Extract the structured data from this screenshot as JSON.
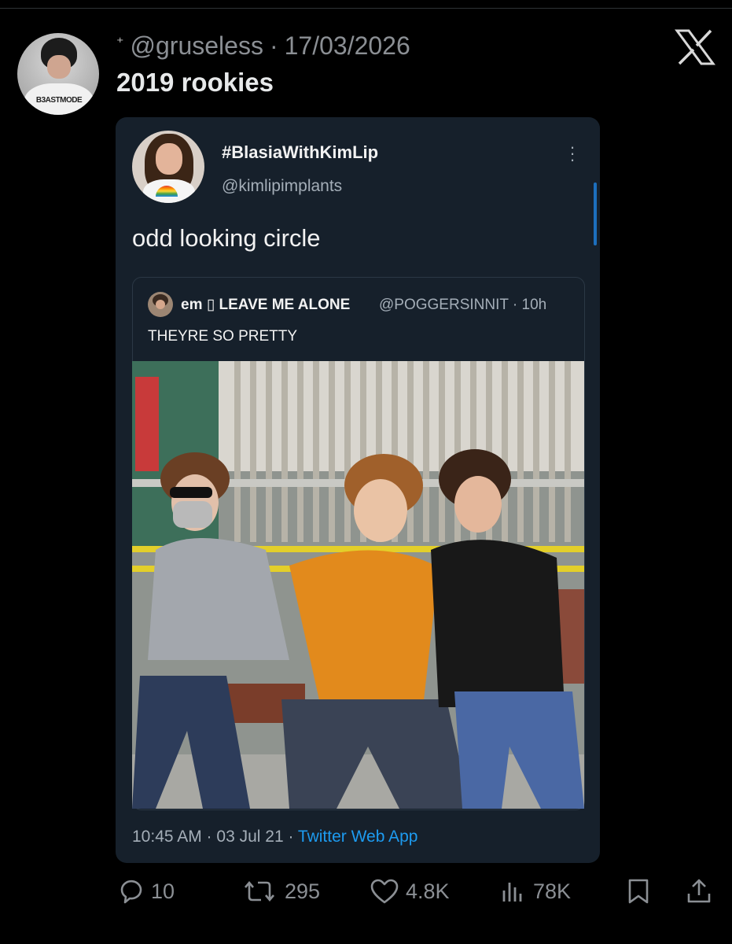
{
  "post": {
    "sparkle": "⁺",
    "handle": "@gruseless",
    "date": "17/03/2026",
    "text": "2019 rookies",
    "avatar_shirt_text": "B3ASTMODE"
  },
  "quoted": {
    "name": "#BlasiaWithKimLip",
    "handle": "@kimlipimplants",
    "text": "odd looking circle",
    "timestamp": "10:45 AM · 03 Jul 21 · ",
    "app": "Twitter Web App",
    "inner": {
      "name": "em ▯ LEAVE ME ALONE",
      "meta": "@POGGERSINNIT · 10h",
      "text": "THEYRE SO PRETTY"
    }
  },
  "actions": {
    "replies": "10",
    "reposts": "295",
    "likes": "4.8K",
    "views": "78K"
  },
  "colors": {
    "background": "#000000",
    "card": "#16202b",
    "link": "#1d9bf0",
    "muted": "#8b8f94"
  },
  "icons": [
    "x-logo-icon",
    "kebab-menu-icon",
    "reply-icon",
    "repost-icon",
    "like-icon",
    "views-icon",
    "bookmark-icon",
    "share-icon"
  ]
}
